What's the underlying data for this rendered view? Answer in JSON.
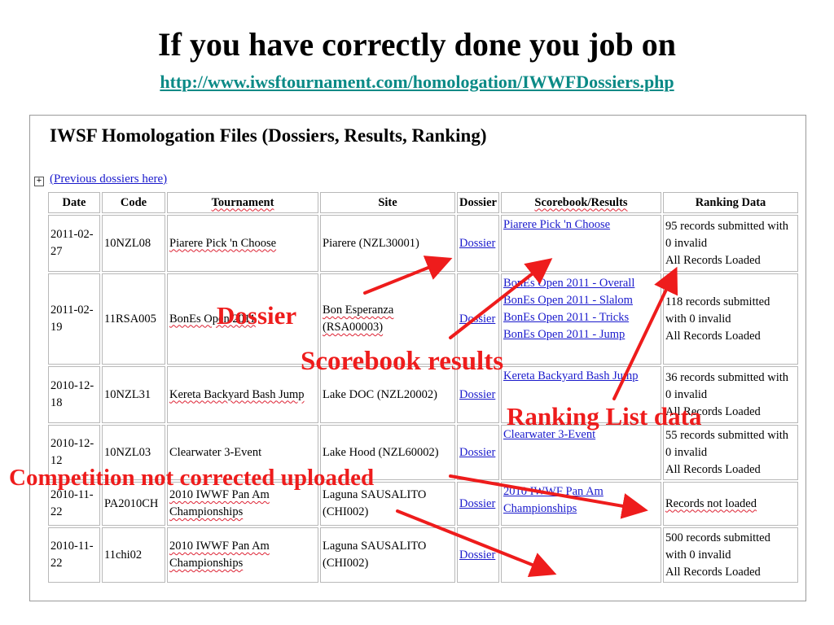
{
  "slide": {
    "title": "If you have correctly done you job on",
    "url": "http://www.iwsftournament.com/homologation/IWWFDossiers.php"
  },
  "page": {
    "heading": "IWSF Homologation Files (Dossiers, Results, Ranking)",
    "expand_icon": "plus-box-icon",
    "previous_link": "(Previous dossiers here)",
    "columns": [
      "Date",
      "Code",
      "Tournament",
      "Site",
      "Dossier",
      "Scorebook/Results",
      "Ranking Data"
    ],
    "rows": [
      {
        "date": "2011-02-27",
        "code": "10NZL08",
        "tournament": "Piarere Pick 'n Choose",
        "site": "Piarere (NZL30001)",
        "dossier": "Dossier",
        "results": [
          "Piarere Pick 'n Choose"
        ],
        "ranking": [
          "95 records submitted with",
          "0 invalid",
          "All Records Loaded"
        ]
      },
      {
        "date": "2011-02-19",
        "code": "11RSA005",
        "tournament": "BonEs Open 2011",
        "site": "Bon Esperanza (RSA00003)",
        "dossier": "Dossier",
        "results": [
          "BonEs Open 2011 - Overall",
          "BonEs Open 2011 - Slalom",
          "BonEs Open 2011 - Tricks",
          "BonEs Open 2011 - Jump"
        ],
        "ranking": [
          "118 records submitted",
          "with 0 invalid",
          "All Records Loaded"
        ]
      },
      {
        "date": "2010-12-18",
        "code": "10NZL31",
        "tournament": "Kereta Backyard Bash Jump",
        "site": "Lake DOC (NZL20002)",
        "dossier": "Dossier",
        "results": [
          "Kereta Backyard Bash Jump"
        ],
        "ranking": [
          "36 records submitted with",
          "0 invalid",
          "All Records Loaded"
        ]
      },
      {
        "date": "2010-12-12",
        "code": "10NZL03",
        "tournament": "Clearwater 3-Event",
        "site": "Lake Hood (NZL60002)",
        "dossier": "Dossier",
        "results": [
          "Clearwater 3-Event"
        ],
        "ranking": [
          "55 records submitted with",
          "0 invalid",
          "All Records Loaded"
        ]
      },
      {
        "date": "2010-11-22",
        "code": "PA2010CH",
        "tournament": "2010 IWWF Pan Am Championships",
        "site": "Laguna SAUSALITO (CHI002)",
        "dossier": "Dossier",
        "results": [
          "2010 IWWF Pan Am Championships"
        ],
        "ranking": [
          "Records not loaded"
        ]
      },
      {
        "date": "2010-11-22",
        "code": "11chi02",
        "tournament": "2010 IWWF Pan Am Championships",
        "site": "Laguna SAUSALITO (CHI002)",
        "dossier": "Dossier",
        "results": [],
        "ranking": [
          "500 records submitted",
          "with 0 invalid",
          "All Records Loaded"
        ]
      }
    ]
  },
  "callouts": {
    "dossier": "Dossier",
    "scorebook": "Scorebook results",
    "ranking": "Ranking List data",
    "competition": "Competition not corrected uploaded"
  },
  "colors": {
    "callout": "#ee1c1c",
    "link": "#1a1acc",
    "url": "#0a8a86"
  }
}
